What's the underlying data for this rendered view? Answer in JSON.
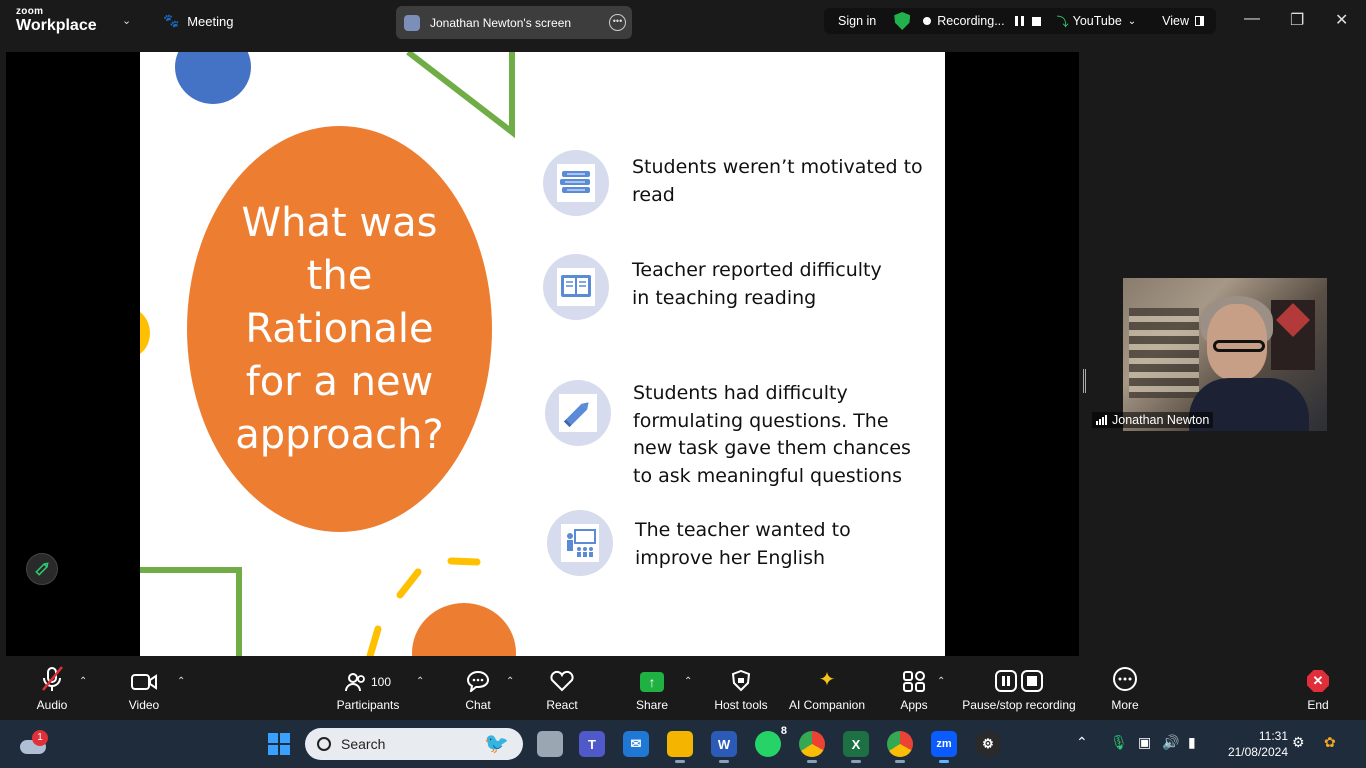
{
  "titlebar": {
    "logo_top": "zoom",
    "logo_bottom": "Workplace",
    "meeting_label": "Meeting",
    "screen_tab": "Jonathan Newton's screen",
    "sign_in": "Sign in",
    "recording": "Recording...",
    "youtube": "YouTube",
    "view": "View"
  },
  "slide": {
    "title": "What was the Rationale for a new approach?",
    "items": [
      {
        "text": "Students weren’t motivated to read",
        "icon": "books-icon"
      },
      {
        "text": "Teacher reported difficulty in teaching reading",
        "icon": "book-open-icon"
      },
      {
        "text": "Students had difficulty formulating questions. The new task gave them chances to ask meaningful questions",
        "icon": "pencil-icon"
      },
      {
        "text": "The teacher wanted to improve her English",
        "icon": "classroom-icon"
      }
    ]
  },
  "participant": {
    "name": "Jonathan Newton"
  },
  "toolbar": {
    "audio": "Audio",
    "video": "Video",
    "participants": "Participants",
    "participant_count": "100",
    "chat": "Chat",
    "react": "React",
    "share": "Share",
    "host_tools": "Host tools",
    "ai_companion": "AI Companion",
    "apps": "Apps",
    "pause_stop": "Pause/stop recording",
    "more": "More",
    "end": "End"
  },
  "taskbar": {
    "search_placeholder": "Search",
    "weather_badge": "1",
    "whatsapp_badge": "8",
    "time": "11:31",
    "date": "21/08/2024"
  },
  "colors": {
    "orange": "#ed7d31",
    "blue": "#4472c4",
    "yellow": "#ffc000",
    "green": "#70ad47",
    "icon_circle": "#d6dced",
    "share_green": "#1fb141",
    "end_red": "#e02e3b"
  }
}
